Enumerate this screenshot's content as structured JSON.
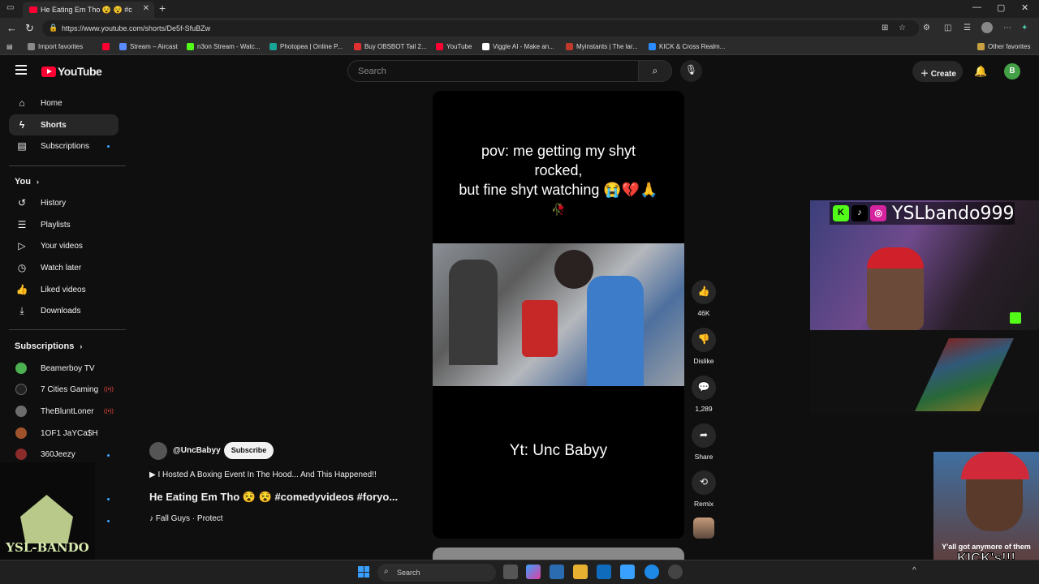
{
  "browser": {
    "tab_title": "He Eating Em Tho 😵 😵 #c",
    "url": "https://www.youtube.com/shorts/De5f-SfuBZw",
    "bookmarks": [
      {
        "label": "Import favorites",
        "color": "#8a8a8a"
      },
      {
        "label": "",
        "color": "#ff0033"
      },
      {
        "label": "Stream – Aircast",
        "color": "#5b8cff"
      },
      {
        "label": "n3on Stream - Watc...",
        "color": "#53fc18"
      },
      {
        "label": "Photopea | Online P...",
        "color": "#18a497"
      },
      {
        "label": "Buy OBSBOT Tail 2...",
        "color": "#e03030"
      },
      {
        "label": "YouTube",
        "color": "#ff0033"
      },
      {
        "label": "Viggle AI - Make an...",
        "color": "#ffffff"
      },
      {
        "label": "Myinstants | The lar...",
        "color": "#c0392b"
      },
      {
        "label": "KICK & Cross Realm...",
        "color": "#2a8cff"
      }
    ],
    "other_favorites": "Other favorites"
  },
  "header": {
    "logo_text": "YouTube",
    "search_placeholder": "Search",
    "create_label": "Create",
    "avatar_letter": "B"
  },
  "sidebar": {
    "main": [
      {
        "label": "Home",
        "icon": "home-icon"
      },
      {
        "label": "Shorts",
        "icon": "shorts-icon"
      },
      {
        "label": "Subscriptions",
        "icon": "subscriptions-icon"
      }
    ],
    "you_heading": "You",
    "you_items": [
      {
        "label": "History",
        "icon": "history-icon"
      },
      {
        "label": "Playlists",
        "icon": "playlists-icon"
      },
      {
        "label": "Your videos",
        "icon": "your-videos-icon"
      },
      {
        "label": "Watch later",
        "icon": "watch-later-icon"
      },
      {
        "label": "Liked videos",
        "icon": "liked-videos-icon"
      },
      {
        "label": "Downloads",
        "icon": "downloads-icon"
      }
    ],
    "subscriptions_heading": "Subscriptions",
    "subscriptions": [
      {
        "label": "Beamerboy TV",
        "color": "#4caf50"
      },
      {
        "label": "7 Cities Gaming",
        "color": "#222222"
      },
      {
        "label": "TheBluntLoner",
        "color": "#6d6d6d"
      },
      {
        "label": "1OF1 JaYCa$H",
        "color": "#a0522d"
      },
      {
        "label": "360Jeezy",
        "color": "#8b2b2b"
      }
    ]
  },
  "short": {
    "caption_line1": "pov: me getting my shyt",
    "caption_line2": "rocked,",
    "caption_line3": "but fine shyt watching 😭💔🙏",
    "caption_emoji": "🥀",
    "credit": "Yt: Unc Babyy",
    "channel": "@UncBabyy",
    "subscribe": "Subscribe",
    "related": "I Hosted A Boxing Event In The Hood... And This Happened!!",
    "title": "He Eating Em Tho 😵 😵 #comedyvideos #foryo...",
    "music": "Fall Guys · Protect"
  },
  "actions": {
    "likes": "46K",
    "dislike": "Dislike",
    "comments": "1,289",
    "share": "Share",
    "remix": "Remix"
  },
  "overlays": {
    "stream_handle": "YSLbando999",
    "meme_small": "Y'all got anymore of them",
    "meme_big": "KICK's!!!",
    "logo_text": "YSL-BANDO"
  },
  "taskbar": {
    "search": "Search"
  }
}
